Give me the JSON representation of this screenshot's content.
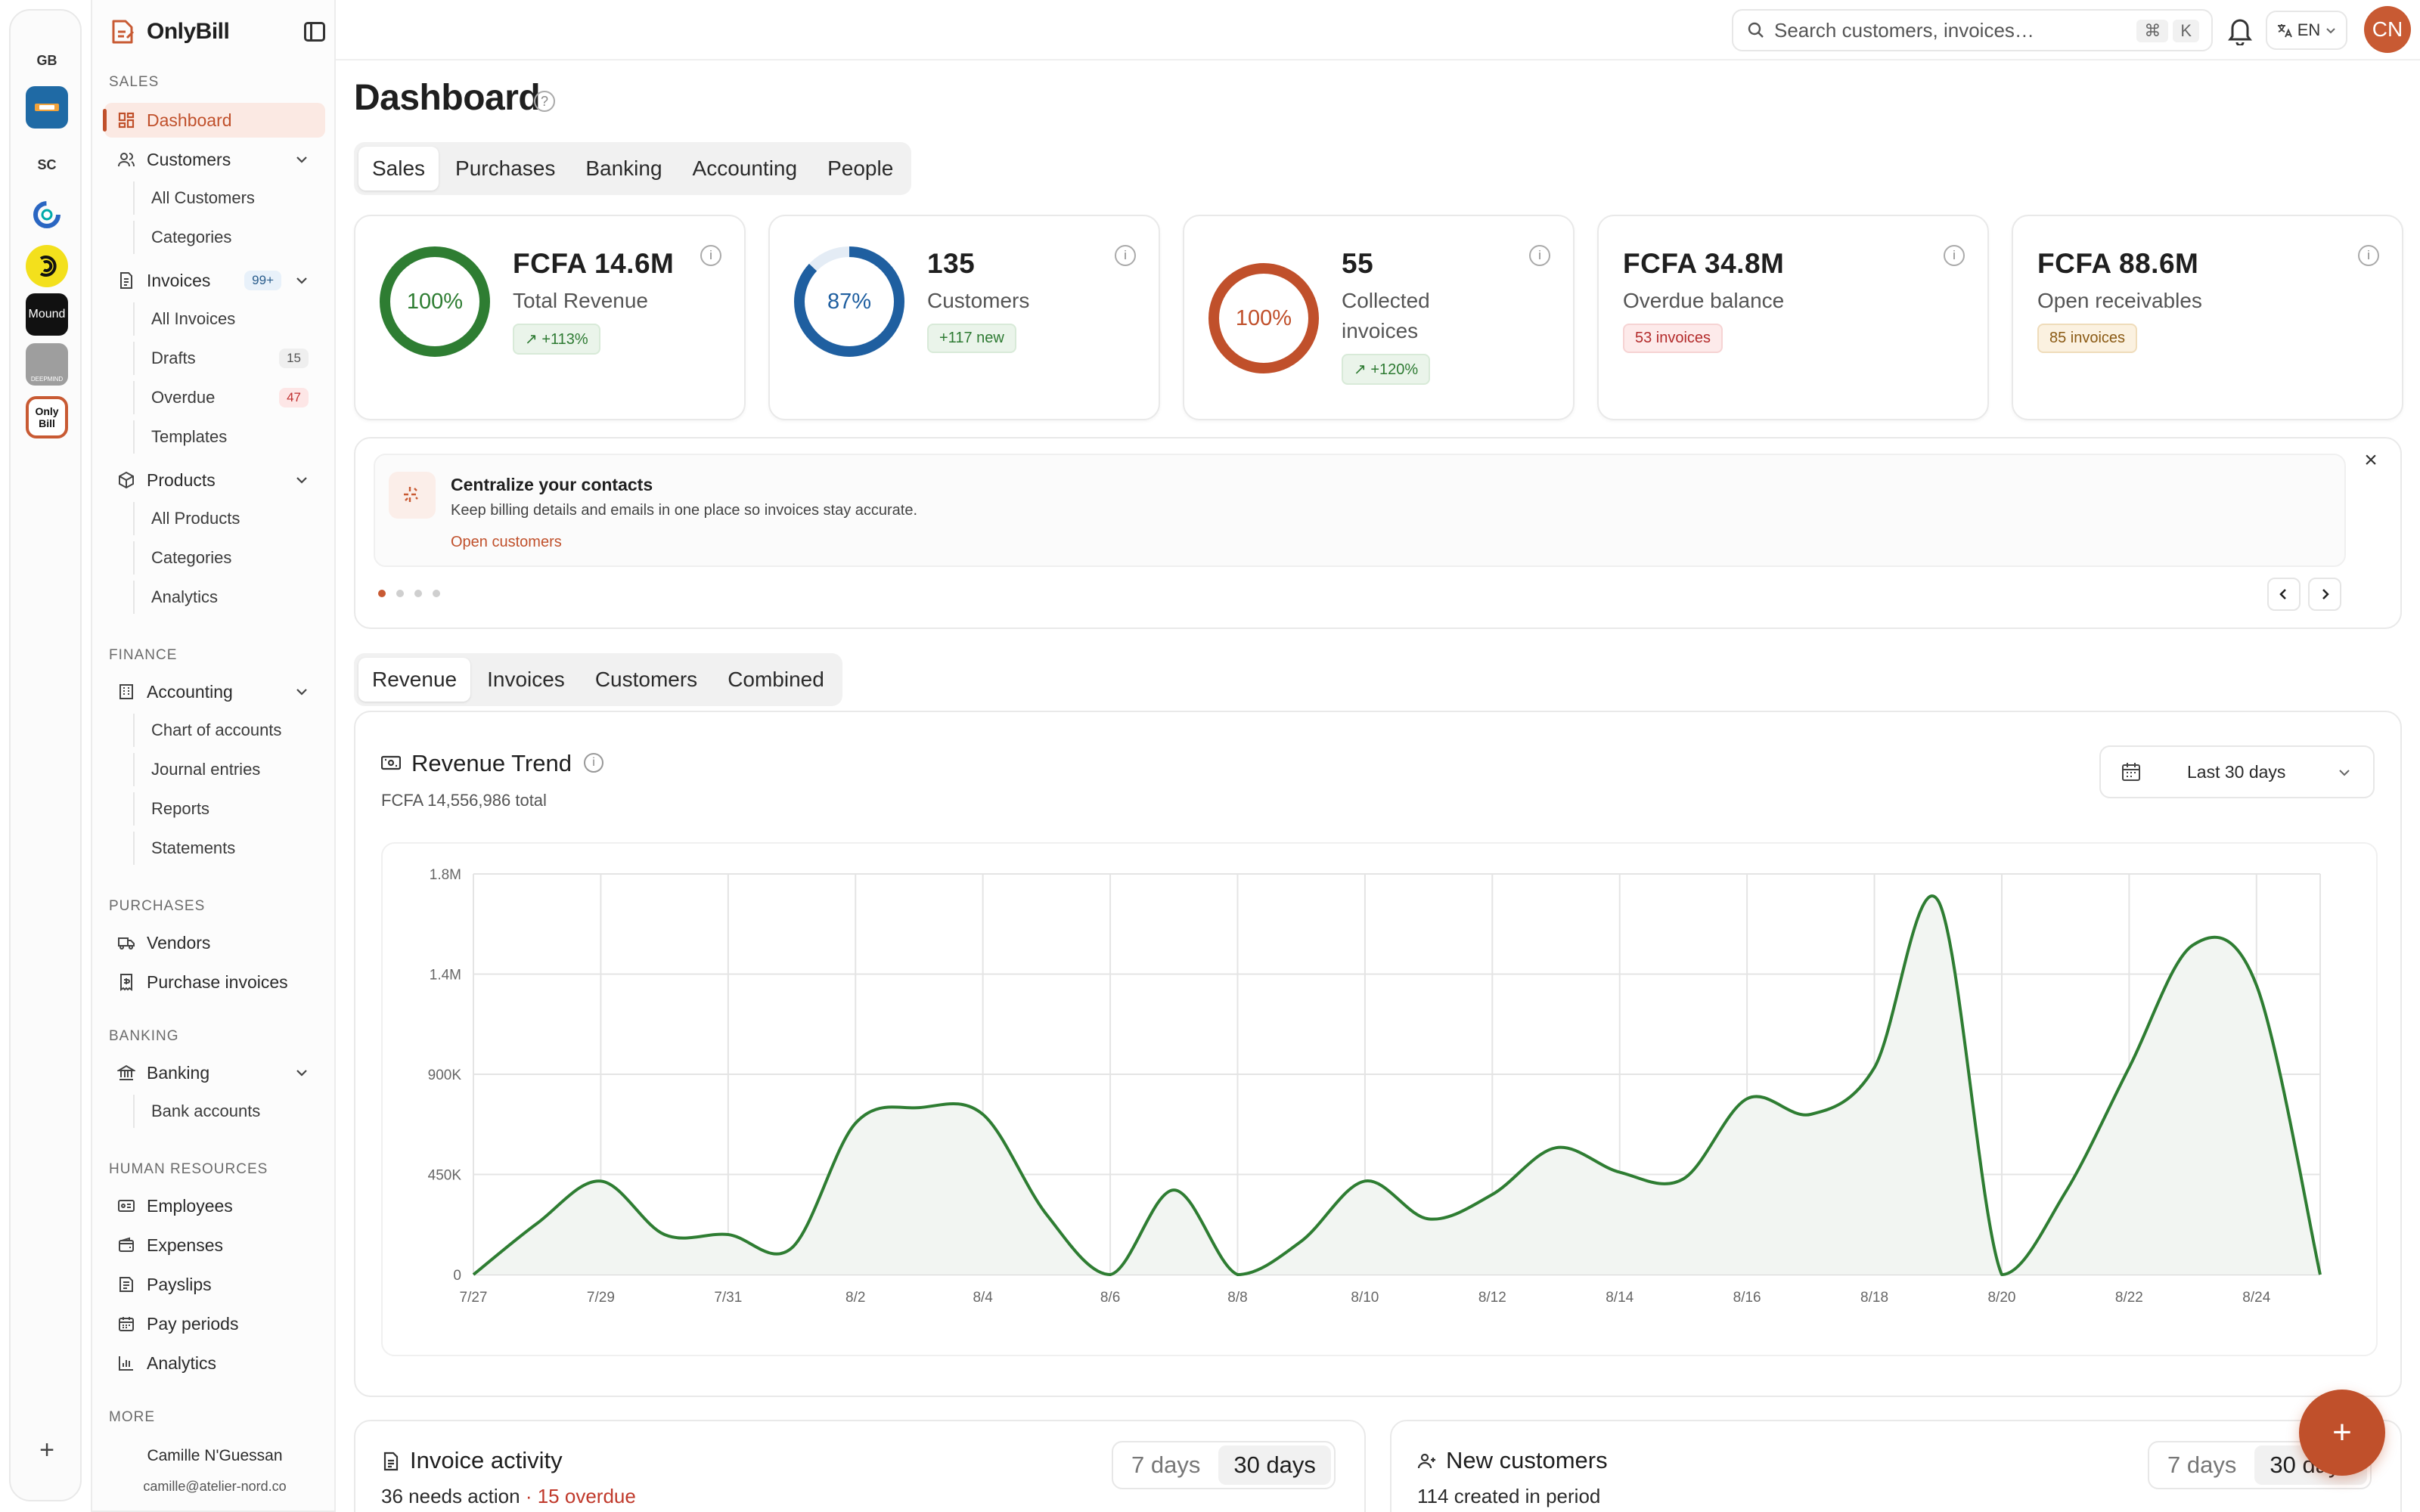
{
  "workspaces": [
    {
      "label": "GB",
      "kind": "text"
    },
    {
      "label": "",
      "kind": "logo",
      "color": "#1f6aa5"
    },
    {
      "label": "SC",
      "kind": "text"
    },
    {
      "label": "",
      "kind": "logo",
      "color": "#2a66c2"
    },
    {
      "label": "",
      "kind": "logo",
      "color": "#f3e01c"
    },
    {
      "label": "Mound",
      "kind": "logo",
      "color": "#111111"
    },
    {
      "label": "DEEPMIND",
      "kind": "logo",
      "color": "#9e9e9e"
    },
    {
      "label": "Only Bill",
      "kind": "logo",
      "color": "#c85a33"
    }
  ],
  "brand": {
    "name": "OnlyBill"
  },
  "sidebar": {
    "sections": {
      "sales": "SALES",
      "finance": "FINANCE",
      "purchases": "PURCHASES",
      "banking": "BANKING",
      "hr": "HUMAN RESOURCES",
      "more": "MORE"
    },
    "dashboard": "Dashboard",
    "customers": {
      "label": "Customers",
      "items": [
        "All Customers",
        "Categories"
      ]
    },
    "invoices": {
      "label": "Invoices",
      "badge": "99+",
      "all": "All Invoices",
      "drafts": "Drafts",
      "drafts_count": "15",
      "overdue": "Overdue",
      "overdue_count": "47",
      "templates": "Templates"
    },
    "products": {
      "label": "Products",
      "items": [
        "All Products",
        "Categories",
        "Analytics"
      ]
    },
    "accounting": {
      "label": "Accounting",
      "items": [
        "Chart of accounts",
        "Journal entries",
        "Reports",
        "Statements"
      ]
    },
    "vendors": "Vendors",
    "purchase_invoices": "Purchase invoices",
    "banking": {
      "label": "Banking",
      "items": [
        "Bank accounts"
      ]
    },
    "hr": {
      "employees": "Employees",
      "expenses": "Expenses",
      "payslips": "Payslips",
      "pay_periods": "Pay periods",
      "analytics": "Analytics"
    },
    "user": {
      "name": "Camille N'Guessan",
      "email": "camille@atelier-nord.co"
    }
  },
  "topbar": {
    "search_placeholder": "Search customers, invoices…",
    "shortcut": [
      "⌘",
      "K"
    ],
    "language": "EN",
    "avatar_initials": "CN"
  },
  "page": {
    "title": "Dashboard",
    "tabs": [
      "Sales",
      "Purchases",
      "Banking",
      "Accounting",
      "People"
    ],
    "active_tab": "Sales"
  },
  "kpis": [
    {
      "ring": "100%",
      "ring_fraction": 1.0,
      "ring_color": "#2e7d32",
      "value": "FCFA 14.6M",
      "label": "Total Revenue",
      "badge": "↗ +113%",
      "badge_style": "green"
    },
    {
      "ring": "87%",
      "ring_fraction": 0.87,
      "ring_color": "#1f5fa0",
      "value": "135",
      "label": "Customers",
      "badge": "+117 new",
      "badge_style": "green"
    },
    {
      "ring": "100%",
      "ring_fraction": 1.0,
      "ring_color": "#c0502b",
      "value": "55",
      "label": "Collected invoices",
      "badge": "↗ +120%",
      "badge_style": "green"
    },
    {
      "value": "FCFA 34.8M",
      "label": "Overdue balance",
      "badge": "53 invoices",
      "badge_style": "red"
    },
    {
      "value": "FCFA 88.6M",
      "label": "Open receivables",
      "badge": "85 invoices",
      "badge_style": "amber"
    }
  ],
  "banner": {
    "title": "Centralize your contacts",
    "description": "Keep billing details and emails in one place so invoices stay accurate.",
    "link": "Open customers",
    "dots": 4,
    "active_dot": 0
  },
  "chart_tabs": [
    "Revenue",
    "Invoices",
    "Customers",
    "Combined"
  ],
  "active_chart_tab": "Revenue",
  "chart_card": {
    "title": "Revenue Trend",
    "total": "FCFA 14,556,986 total",
    "range": "Last 30 days"
  },
  "chart_data": {
    "type": "area",
    "title": "Revenue Trend",
    "x": [
      "7/27",
      "7/28",
      "7/29",
      "7/30",
      "7/31",
      "8/1",
      "8/2",
      "8/3",
      "8/4",
      "8/5",
      "8/6",
      "8/7",
      "8/8",
      "8/9",
      "8/10",
      "8/11",
      "8/12",
      "8/13",
      "8/14",
      "8/15",
      "8/16",
      "8/17",
      "8/18",
      "8/19",
      "8/20",
      "8/21",
      "8/22",
      "8/23",
      "8/24",
      "8/25"
    ],
    "x_tick_labels": [
      "7/27",
      "7/29",
      "7/31",
      "8/2",
      "8/4",
      "8/6",
      "8/8",
      "8/10",
      "8/12",
      "8/14",
      "8/16",
      "8/18",
      "8/20",
      "8/22",
      "8/24"
    ],
    "y_tick_labels": [
      "0",
      "450K",
      "900K",
      "1.4M",
      "1.8M"
    ],
    "y_ticks": [
      0,
      450000,
      900000,
      1350000,
      1800000
    ],
    "ylim": [
      0,
      1800000
    ],
    "series": [
      {
        "values": [
          0,
          230000,
          420000,
          180000,
          180000,
          120000,
          680000,
          750000,
          720000,
          270000,
          0,
          380000,
          0,
          150000,
          420000,
          250000,
          360000,
          570000,
          460000,
          430000,
          790000,
          720000,
          930000,
          1680000,
          0,
          370000,
          930000,
          1480000,
          1300000,
          0
        ]
      }
    ],
    "line_color": "#2e7d32",
    "grid": true
  },
  "bottom_cards": [
    {
      "title": "Invoice activity",
      "count": "36",
      "count_label": "needs action",
      "extra": "· 15 overdue",
      "ranges": [
        "7 days",
        "30 days"
      ],
      "active_range": "30 days"
    },
    {
      "title": "New customers",
      "count": "114",
      "count_label": "created in period",
      "ranges": [
        "7 days",
        "30 days"
      ],
      "active_range": "30 days"
    }
  ],
  "fab_label": "+"
}
